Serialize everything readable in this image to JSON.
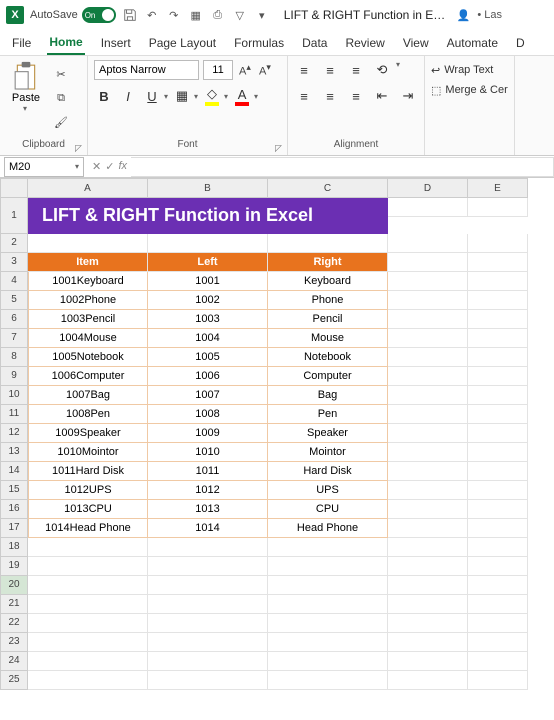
{
  "titlebar": {
    "autosave_label": "AutoSave",
    "autosave_state": "On",
    "doc_title": "LIFT & RIGHT Function in E…",
    "extra": "• Las"
  },
  "tabs": [
    "File",
    "Home",
    "Insert",
    "Page Layout",
    "Formulas",
    "Data",
    "Review",
    "View",
    "Automate",
    "D"
  ],
  "active_tab": 1,
  "ribbon": {
    "clipboard": {
      "paste": "Paste",
      "label": "Clipboard"
    },
    "font": {
      "name": "Aptos Narrow",
      "size": "11",
      "label": "Font",
      "bold": "B",
      "italic": "I",
      "underline": "U"
    },
    "align": {
      "label": "Alignment",
      "wrap": "Wrap Text",
      "merge": "Merge & Cer"
    }
  },
  "name_box": "M20",
  "fx_label": "fx",
  "columns": [
    "A",
    "B",
    "C",
    "D",
    "E"
  ],
  "row_count": 25,
  "selected_row": 20,
  "sheet_title": "LIFT & RIGHT Function in Excel",
  "headers": {
    "item": "Item",
    "left": "Left",
    "right": "Right"
  },
  "data": [
    {
      "item": "1001Keyboard",
      "left": "1001",
      "right": "Keyboard"
    },
    {
      "item": "1002Phone",
      "left": "1002",
      "right": "Phone"
    },
    {
      "item": "1003Pencil",
      "left": "1003",
      "right": "Pencil"
    },
    {
      "item": "1004Mouse",
      "left": "1004",
      "right": "Mouse"
    },
    {
      "item": "1005Notebook",
      "left": "1005",
      "right": "Notebook"
    },
    {
      "item": "1006Computer",
      "left": "1006",
      "right": "Computer"
    },
    {
      "item": "1007Bag",
      "left": "1007",
      "right": "Bag"
    },
    {
      "item": "1008Pen",
      "left": "1008",
      "right": "Pen"
    },
    {
      "item": "1009Speaker",
      "left": "1009",
      "right": "Speaker"
    },
    {
      "item": "1010Mointor",
      "left": "1010",
      "right": "Mointor"
    },
    {
      "item": "1011Hard Disk",
      "left": "1011",
      "right": "Hard Disk"
    },
    {
      "item": "1012UPS",
      "left": "1012",
      "right": "UPS"
    },
    {
      "item": "1013CPU",
      "left": "1013",
      "right": "CPU"
    },
    {
      "item": "1014Head Phone",
      "left": "1014",
      "right": "Head Phone"
    }
  ]
}
